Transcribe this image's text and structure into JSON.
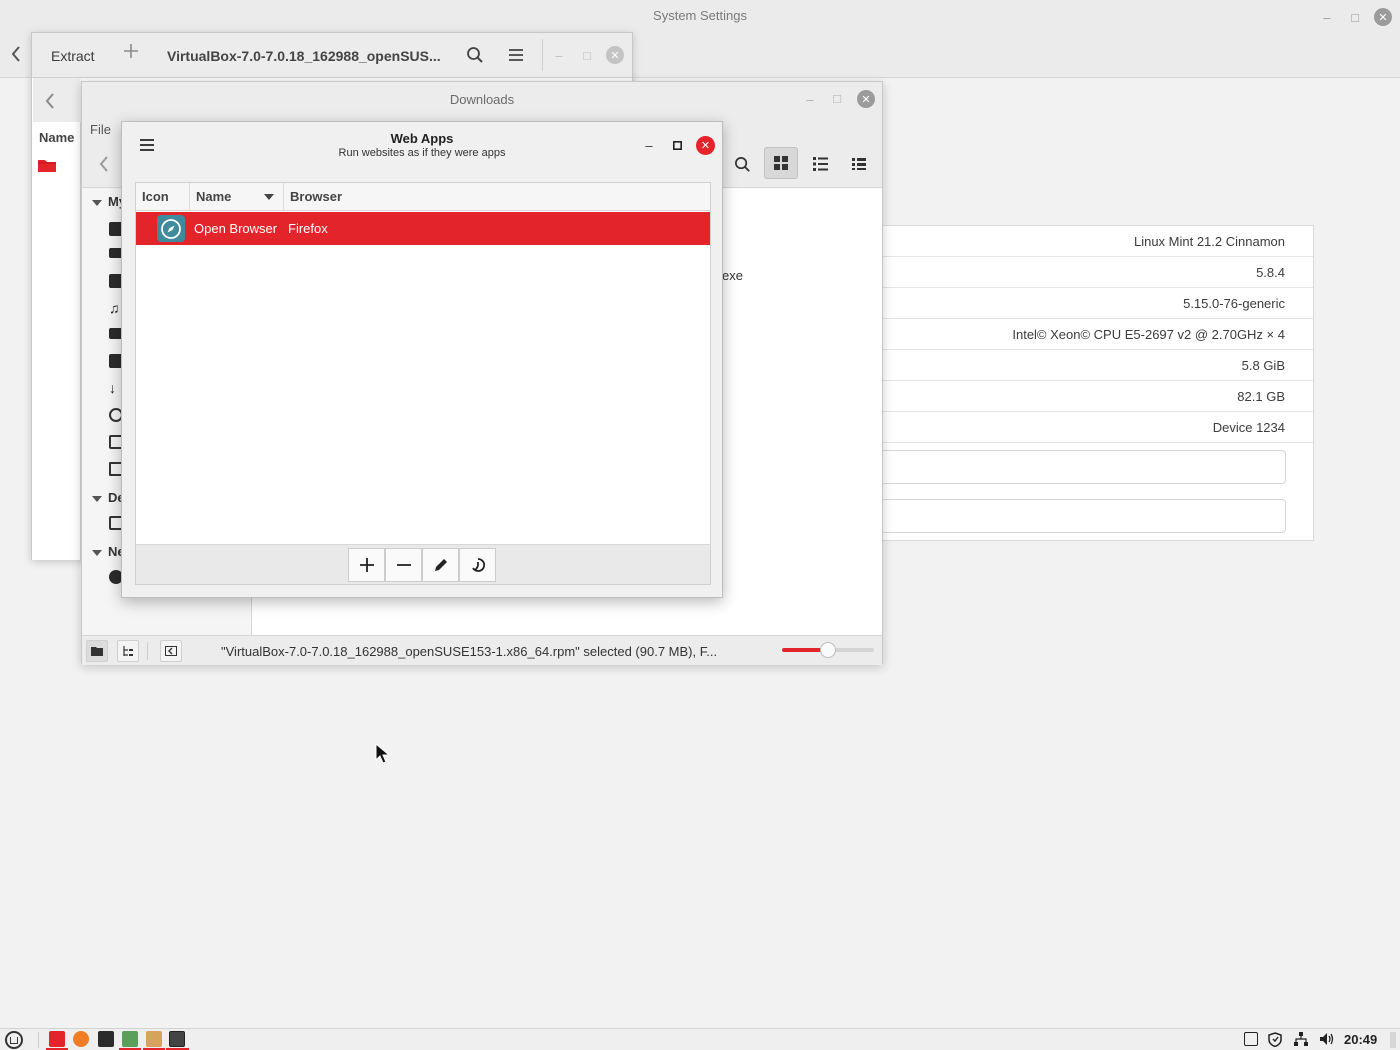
{
  "system_settings": {
    "title": "System Settings",
    "info_values": [
      "Linux Mint 21.2 Cinnamon",
      "5.8.4",
      "5.15.0-76-generic",
      "Intel© Xeon© CPU E5-2697 v2 @ 2.70GHz × 4",
      "5.8 GiB",
      "82.1 GB",
      "Device 1234"
    ]
  },
  "archive_manager": {
    "extract_label": "Extract",
    "title": "VirtualBox-7.0-7.0.18_162988_openSUS...",
    "name_column": "Name"
  },
  "files": {
    "title": "Downloads",
    "menu_file": "File",
    "partial_filename": "exe",
    "sidebar_headers": [
      "My",
      "De",
      "Ne"
    ],
    "status_text": "\"VirtualBox-7.0-7.0.18_162988_openSUSE153-1.x86_64.rpm\" selected (90.7 MB), F...",
    "zoom_level_fraction": 0.5
  },
  "webapps": {
    "title": "Web Apps",
    "subtitle": "Run websites as if they were apps",
    "columns": [
      "Icon",
      "Name",
      "Browser"
    ],
    "rows": [
      {
        "name": "Open Browser",
        "browser": "Firefox",
        "selected": true
      }
    ]
  },
  "panel": {
    "clock": "20:49"
  },
  "colors": {
    "accent": "#e3242b",
    "window_bg": "#f2f2f2"
  }
}
